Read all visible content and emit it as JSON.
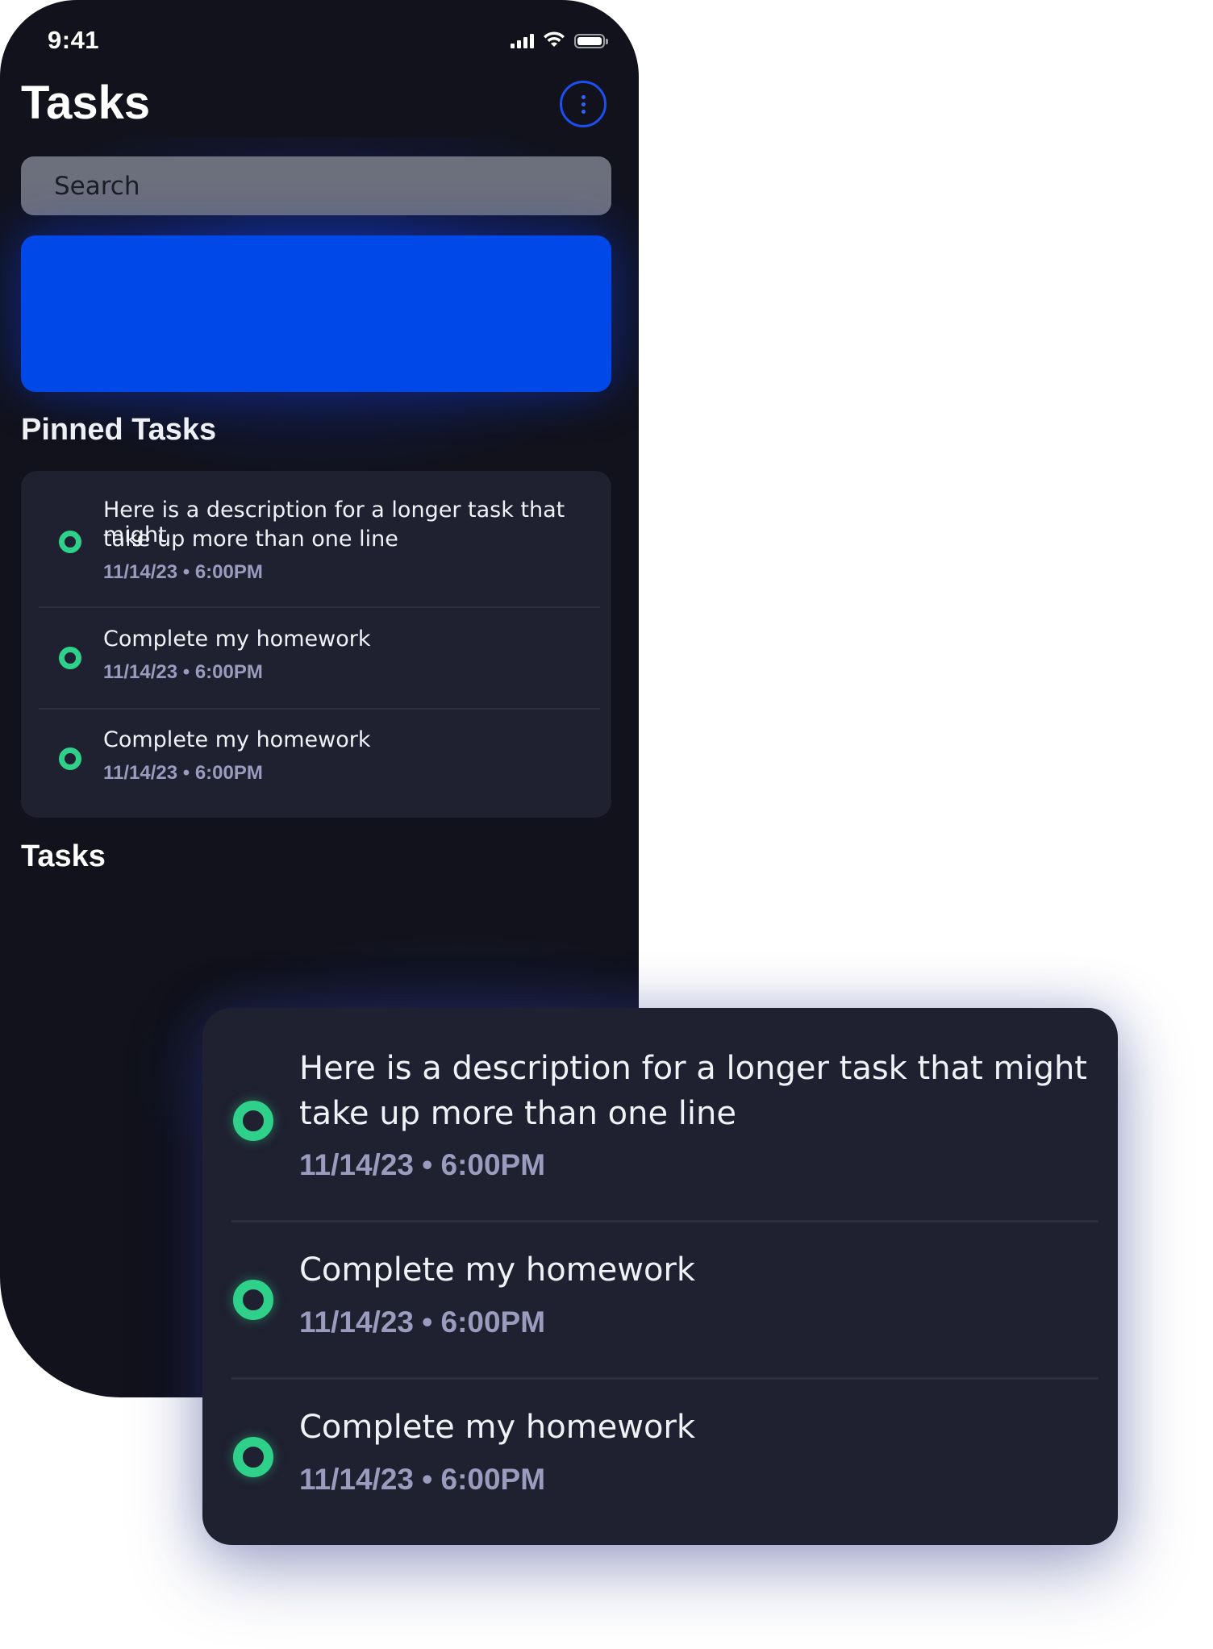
{
  "status_bar": {
    "time": "9:41"
  },
  "header": {
    "title": "Tasks"
  },
  "search": {
    "placeholder": "Search"
  },
  "pinned": {
    "title": "Pinned Tasks",
    "tasks": [
      {
        "line1": "Here is a description for a longer task that might",
        "line2": "take up more than one line",
        "meta": "11/14/23 • 6:00PM"
      },
      {
        "line1": "Complete my homework",
        "meta": "11/14/23 • 6:00PM"
      },
      {
        "line1": "Complete my homework",
        "meta": "11/14/23 • 6:00PM"
      }
    ]
  },
  "tasks_section": {
    "title": "Tasks"
  },
  "icons": {
    "more": "more-vertical-icon",
    "signal": "signal-icon",
    "wifi": "wifi-icon",
    "battery": "battery-icon",
    "task_status": "status-ring-icon"
  },
  "colors": {
    "background": "#11121b",
    "card": "#1f2030",
    "accent": "#0049e8",
    "status_ring": "#2fd08a",
    "meta_text": "#9a9bbd"
  }
}
